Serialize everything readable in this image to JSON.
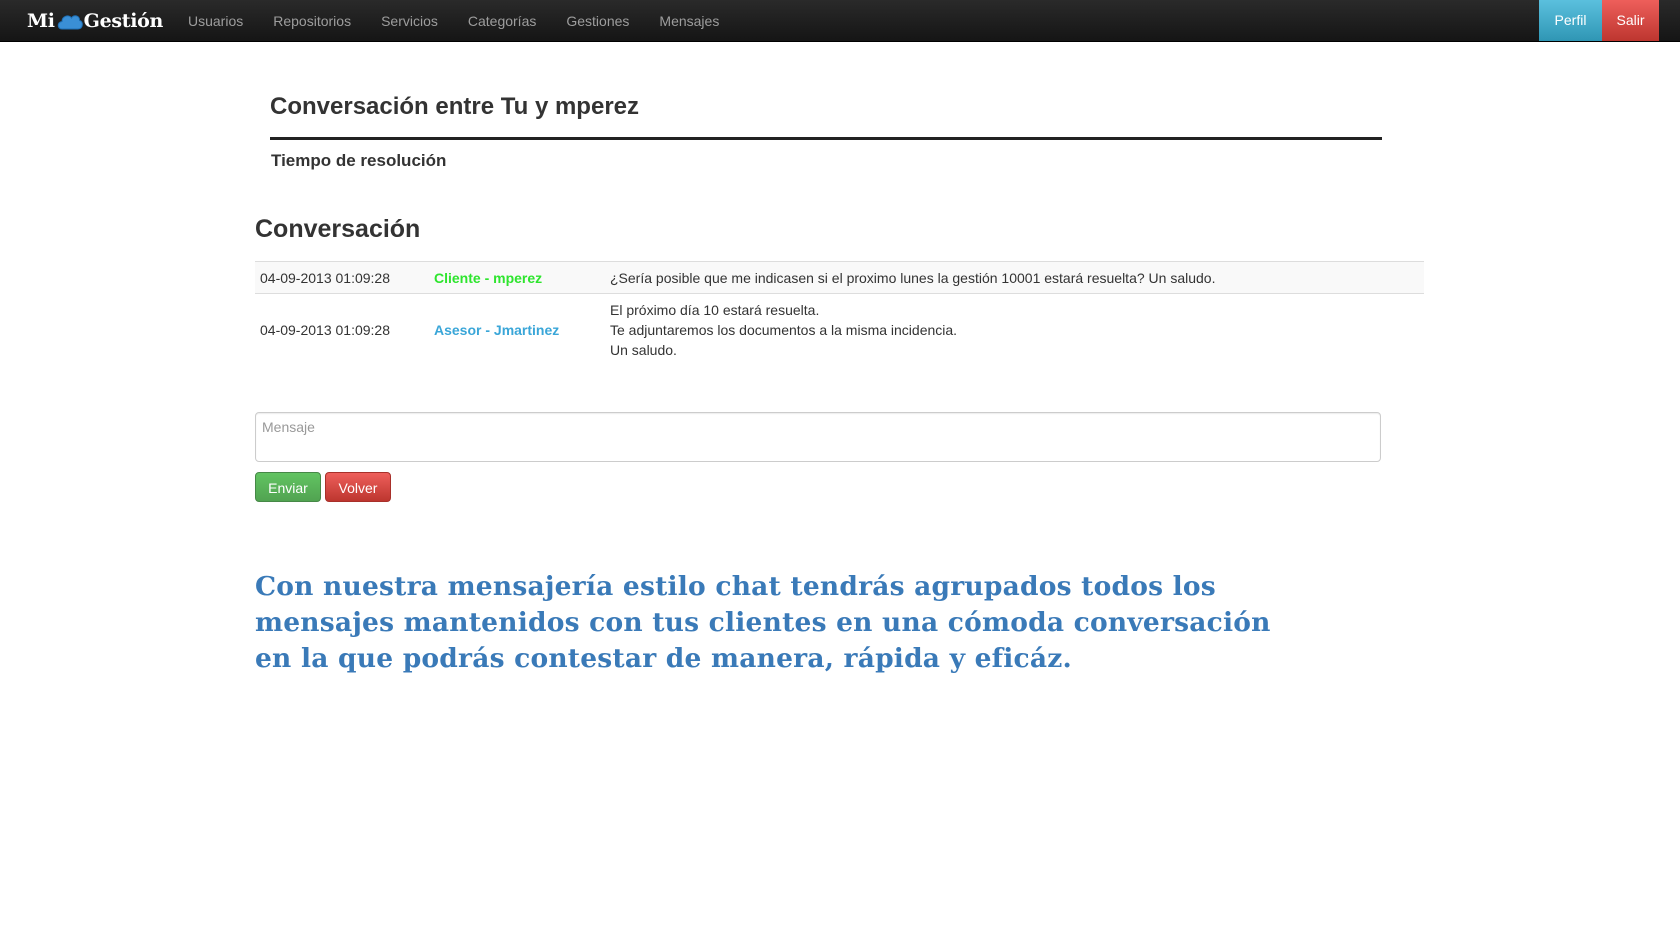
{
  "navbar": {
    "brand_left": "Mi",
    "brand_right": "Gestión",
    "links": [
      "Usuarios",
      "Repositorios",
      "Servicios",
      "Categorías",
      "Gestiones",
      "Mensajes"
    ],
    "profile_label": "Perfil",
    "logout_label": "Salir",
    "colors": {
      "profile": "#2f96b4",
      "logout": "#bd362f"
    }
  },
  "header": {
    "title": "Conversación entre Tu y mperez",
    "resolution_label": "Tiempo de resolución"
  },
  "conversation": {
    "title": "Conversación",
    "messages": [
      {
        "date": "04-09-2013 01:09:28",
        "author": "Cliente - mperez",
        "author_color": "#2ee52e",
        "text": [
          "¿Sería posible que me indicasen si el proximo lunes la gestión 10001 estará resuelta? Un saludo."
        ]
      },
      {
        "date": "04-09-2013 01:09:28",
        "author": "Asesor - Jmartinez",
        "author_color": "#3aa6d8",
        "text": [
          "El próximo día 10 estará resuelta.",
          "Te adjuntaremos los documentos a la misma incidencia.",
          "Un saludo."
        ]
      }
    ]
  },
  "reply": {
    "placeholder": "Mensaje",
    "send_label": "Enviar",
    "back_label": "Volver"
  },
  "promo": {
    "lines": [
      "Con nuestra mensajería estilo chat tendrás agrupados todos los",
      "mensajes mantenidos con tus clientes en una cómoda conversación",
      "en la que podrás contestar de manera, rápida y eficáz."
    ]
  }
}
